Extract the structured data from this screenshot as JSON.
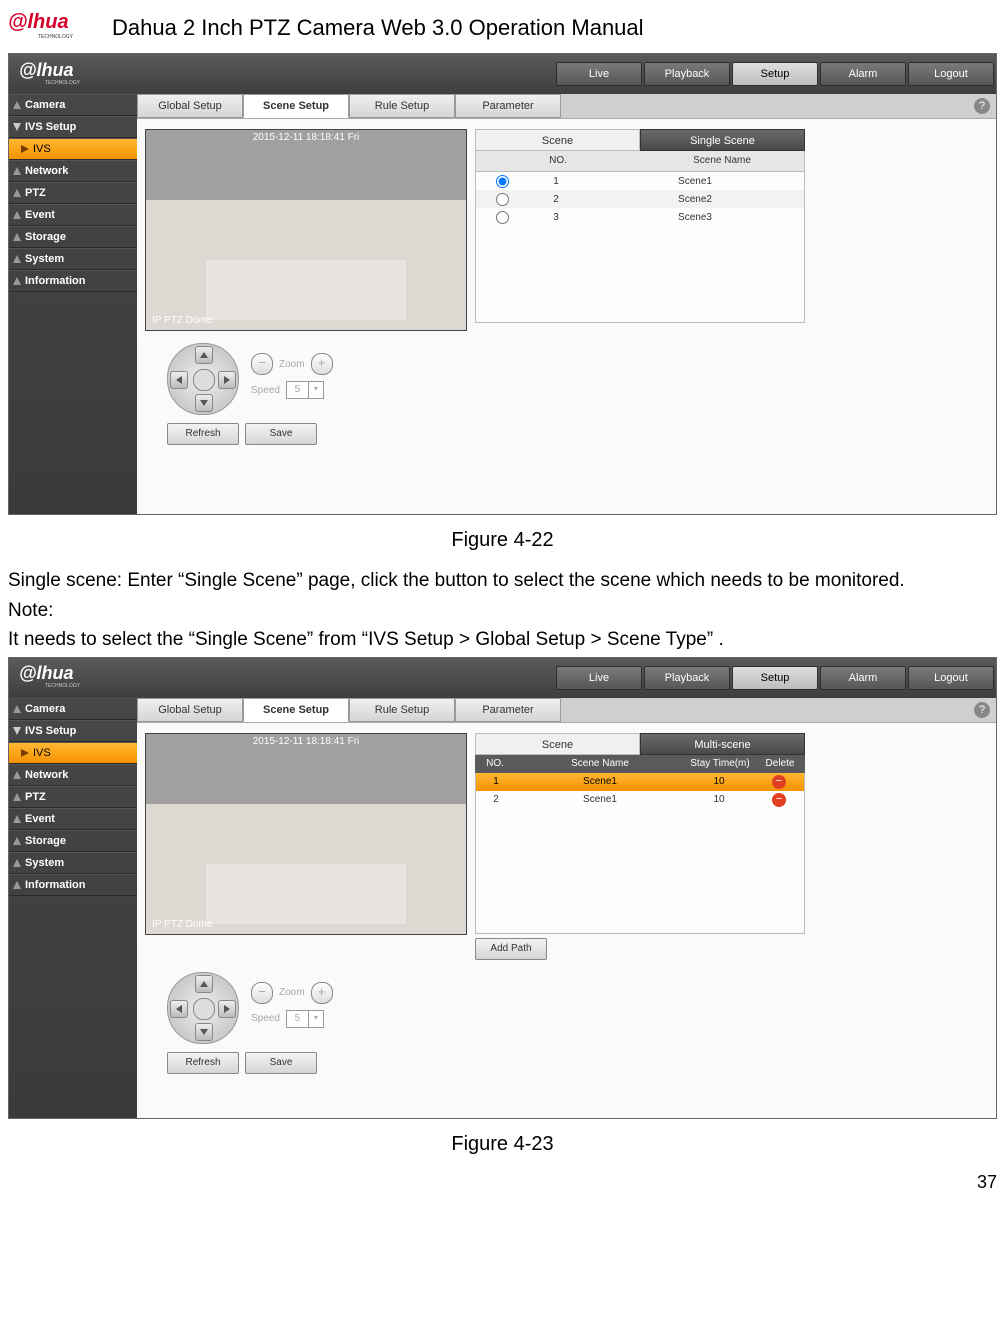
{
  "doc": {
    "title": "Dahua 2 Inch PTZ Camera Web 3.0 Operation Manual",
    "figure22": "Figure 4-22",
    "figure23": "Figure 4-23",
    "para1": "Single scene: Enter “Single Scene” page, click the button to select the scene which needs to be monitored.",
    "note_label": "Note:",
    "note_text": "It needs to select the “Single Scene” from  “IVS Setup > Global Setup > Scene Type” .",
    "page_number": "37"
  },
  "logo_text": "alhua",
  "logo_sub": "TECHNOLOGY",
  "topnav": [
    "Live",
    "Playback",
    "Setup",
    "Alarm",
    "Logout"
  ],
  "topnav_active": "Setup",
  "sidebar": {
    "items": [
      {
        "label": "Camera",
        "type": "top"
      },
      {
        "label": "IVS Setup",
        "type": "top"
      },
      {
        "label": "IVS",
        "type": "active"
      },
      {
        "label": "Network",
        "type": "top"
      },
      {
        "label": "PTZ",
        "type": "top"
      },
      {
        "label": "Event",
        "type": "top"
      },
      {
        "label": "Storage",
        "type": "top"
      },
      {
        "label": "System",
        "type": "top"
      },
      {
        "label": "Information",
        "type": "top"
      }
    ]
  },
  "subtabs": [
    "Global Setup",
    "Scene Setup",
    "Rule Setup",
    "Parameter"
  ],
  "subtab_active": "Scene Setup",
  "preview": {
    "osd_top": "2015-12-11 18:18:41 Fri",
    "osd_bot": "IP PTZ Dome"
  },
  "single_scene": {
    "scene_label": "Scene",
    "mode_label": "Single Scene",
    "col_no": "NO.",
    "col_name": "Scene Name",
    "rows": [
      {
        "no": "1",
        "name": "Scene1",
        "selected": true
      },
      {
        "no": "2",
        "name": "Scene2",
        "selected": false
      },
      {
        "no": "3",
        "name": "Scene3",
        "selected": false
      }
    ]
  },
  "multi_scene": {
    "scene_label": "Scene",
    "mode_label": "Multi-scene",
    "col_no": "NO.",
    "col_name": "Scene Name",
    "col_stay": "Stay Time(m)",
    "col_del": "Delete",
    "rows": [
      {
        "no": "1",
        "name": "Scene1",
        "stay": "10"
      },
      {
        "no": "2",
        "name": "Scene1",
        "stay": "10"
      }
    ],
    "add_path": "Add Path"
  },
  "ptz": {
    "zoom_label": "Zoom",
    "speed_label": "Speed",
    "speed_value": "5",
    "minus": "−",
    "plus": "+"
  },
  "buttons": {
    "refresh": "Refresh",
    "save": "Save"
  }
}
